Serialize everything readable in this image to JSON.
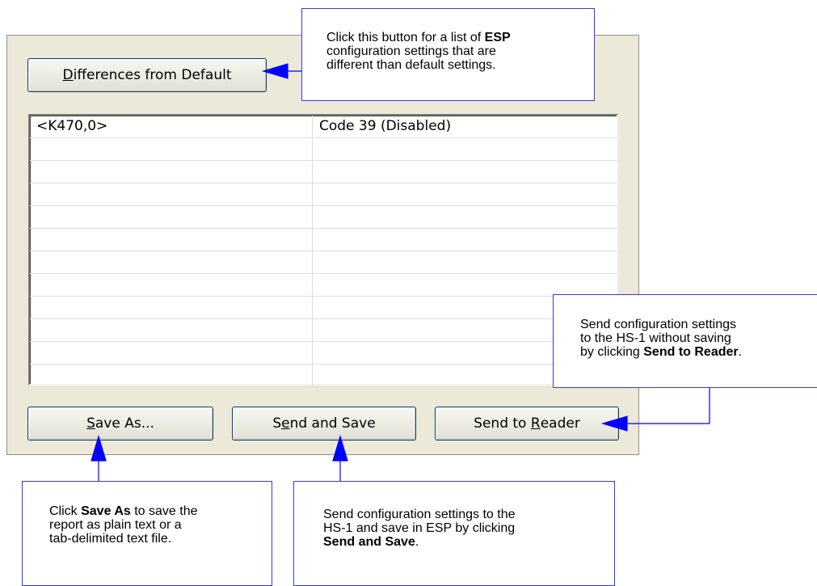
{
  "dialog": {
    "differences_button": {
      "pre": "",
      "mnemonic": "D",
      "post": "ifferences from Default"
    },
    "report_rows": [
      {
        "command": "<K470,0>",
        "description": "Code 39 (Disabled)"
      },
      {
        "command": "",
        "description": ""
      },
      {
        "command": "",
        "description": ""
      },
      {
        "command": "",
        "description": ""
      },
      {
        "command": "",
        "description": ""
      },
      {
        "command": "",
        "description": ""
      },
      {
        "command": "",
        "description": ""
      },
      {
        "command": "",
        "description": ""
      },
      {
        "command": "",
        "description": ""
      },
      {
        "command": "",
        "description": ""
      },
      {
        "command": "",
        "description": ""
      },
      {
        "command": "",
        "description": ""
      }
    ],
    "save_as_button": {
      "pre": "",
      "mnemonic": "S",
      "post": "ave As..."
    },
    "send_and_save_button": {
      "pre": "S",
      "mnemonic": "e",
      "post": "nd and Save"
    },
    "send_to_reader_button": {
      "pre": "Send to ",
      "mnemonic": "R",
      "post": "eader"
    }
  },
  "callouts": {
    "differences": {
      "line1_pre": "Click this button for a list of ",
      "line1_bold": "ESP",
      "line2": "configuration settings that are",
      "line3": "different than default settings."
    },
    "send_to_reader": {
      "line1": "Send configuration settings",
      "line2": "to the HS-1 without saving",
      "line3_pre": "by clicking ",
      "line3_bold": "Send to Reader",
      "line3_post": "."
    },
    "save_as": {
      "line1_pre": "Click ",
      "line1_bold": "Save As",
      "line1_post": " to save the",
      "line2": "report as plain text or a",
      "line3": "tab-delimited text file."
    },
    "send_and_save": {
      "line1": "Send configuration settings to the",
      "line2": "HS-1 and save in ESP by clicking",
      "line3_bold": "Send and Save",
      "line3_post": "."
    }
  },
  "colors": {
    "callout_border": "#3a3ad8",
    "arrow": "#0000ff",
    "dialog_bg": "#ece9d8"
  }
}
